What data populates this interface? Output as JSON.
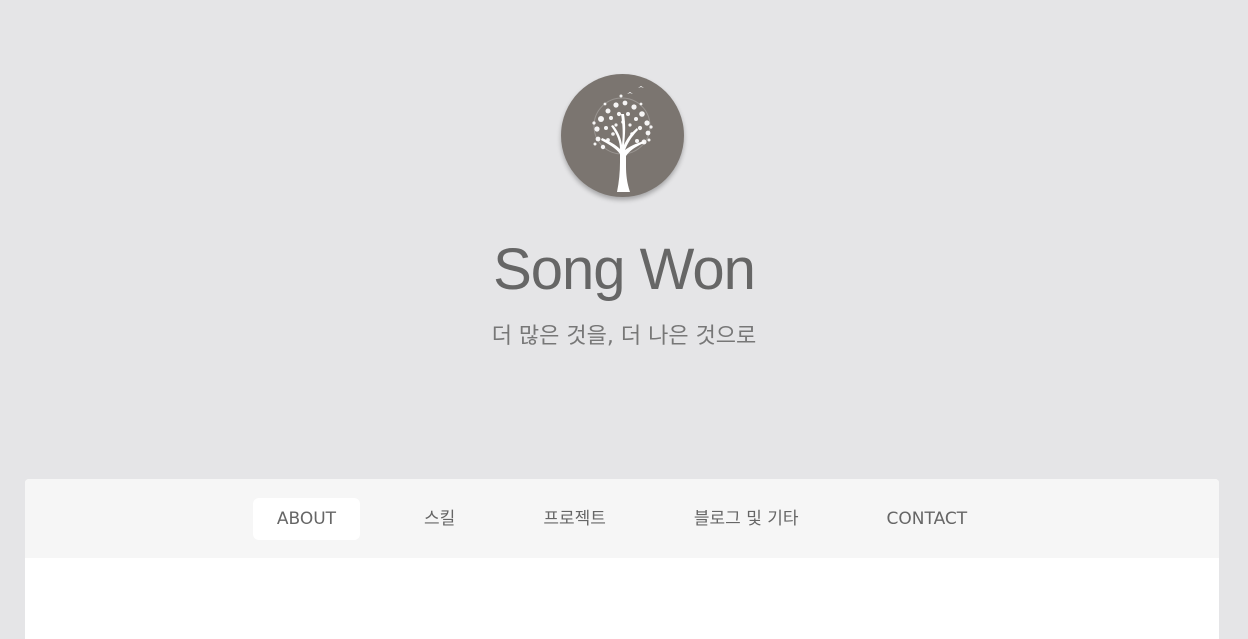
{
  "header": {
    "avatar_icon": "tree-icon",
    "title": "Song Won",
    "tagline": "더 많은 것을, 더 나은 것으로"
  },
  "nav": {
    "tabs": [
      {
        "label": "ABOUT",
        "active": true
      },
      {
        "label": "스킬",
        "active": false
      },
      {
        "label": "프로젝트",
        "active": false
      },
      {
        "label": "블로그 및 기타",
        "active": false
      },
      {
        "label": "CONTACT",
        "active": false
      }
    ]
  },
  "colors": {
    "background": "#e5e5e7",
    "avatar": "#7b7570",
    "text": "#666666",
    "navbar": "#f6f6f6",
    "panel": "#ffffff"
  }
}
